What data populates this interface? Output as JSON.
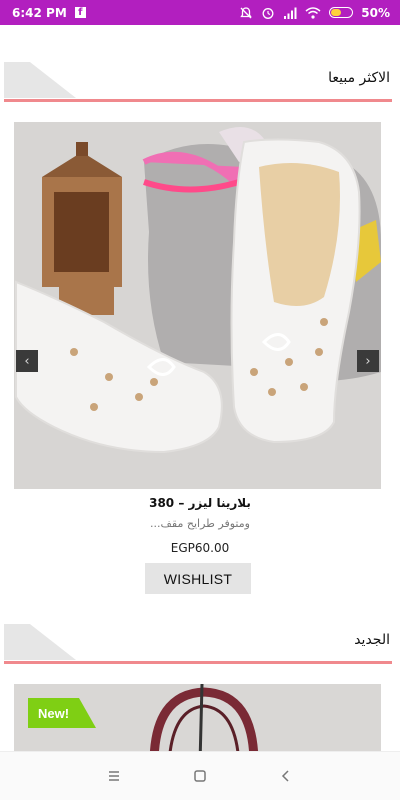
{
  "status_bar": {
    "time": "6:42 PM",
    "app_notification": "f",
    "battery_percent": "50%",
    "battery_level": 0.5,
    "bg_color": "#b21fbf"
  },
  "sections": [
    {
      "title": "الاكثر مبيعا",
      "product": {
        "name": "بلارينا ليزر – 380",
        "description": "ومتوفر طرايح مقف...",
        "price": "EGP60.00",
        "wishlist_label": "WISHLIST",
        "prev_arrow": "‹",
        "next_arrow": "›"
      }
    },
    {
      "title": "الجديد",
      "badge": "New!"
    }
  ],
  "colors": {
    "accent_rule": "#f0898d",
    "new_badge": "#7fcf14",
    "wishlist_bg": "#e4e4e4"
  }
}
